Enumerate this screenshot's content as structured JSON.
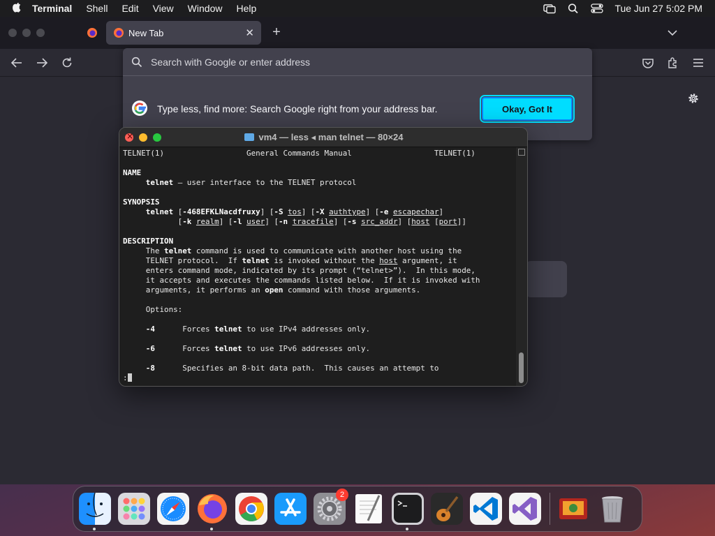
{
  "menubar": {
    "app_name": "Terminal",
    "menus": [
      "Shell",
      "Edit",
      "View",
      "Window",
      "Help"
    ],
    "clock": "Tue Jun 27  5:02 PM"
  },
  "browser": {
    "tab_title": "New Tab",
    "tab_close": "✕",
    "new_tab": "+",
    "search_placeholder": "Search with Google or enter address",
    "promo_text": "Type less, find more: Search Google right from your address bar.",
    "promo_button": "Okay, Got It"
  },
  "terminal": {
    "title": "vm4 — less ◂ man telnet — 80×24",
    "lines": [
      [
        [
          "t",
          "TELNET(1)                  General Commands Manual                  TELNET(1)"
        ]
      ],
      [],
      [
        [
          "b",
          "NAME"
        ]
      ],
      [
        [
          "t",
          "     "
        ],
        [
          "b",
          "telnet"
        ],
        [
          "t",
          " – user interface to the TELNET protocol"
        ]
      ],
      [],
      [
        [
          "b",
          "SYNOPSIS"
        ]
      ],
      [
        [
          "t",
          "     "
        ],
        [
          "b",
          "telnet"
        ],
        [
          "t",
          " ["
        ],
        [
          "b",
          "-468EFKLNacdfruxy"
        ],
        [
          "t",
          "] ["
        ],
        [
          "b",
          "-S"
        ],
        [
          "t",
          " "
        ],
        [
          "u",
          "tos"
        ],
        [
          "t",
          "] ["
        ],
        [
          "b",
          "-X"
        ],
        [
          "t",
          " "
        ],
        [
          "u",
          "authtype"
        ],
        [
          "t",
          "] ["
        ],
        [
          "b",
          "-e"
        ],
        [
          "t",
          " "
        ],
        [
          "u",
          "escapechar"
        ],
        [
          "t",
          "]"
        ]
      ],
      [
        [
          "t",
          "            ["
        ],
        [
          "b",
          "-k"
        ],
        [
          "t",
          " "
        ],
        [
          "u",
          "realm"
        ],
        [
          "t",
          "] ["
        ],
        [
          "b",
          "-l"
        ],
        [
          "t",
          " "
        ],
        [
          "u",
          "user"
        ],
        [
          "t",
          "] ["
        ],
        [
          "b",
          "-n"
        ],
        [
          "t",
          " "
        ],
        [
          "u",
          "tracefile"
        ],
        [
          "t",
          "] ["
        ],
        [
          "b",
          "-s"
        ],
        [
          "t",
          " "
        ],
        [
          "u",
          "src_addr"
        ],
        [
          "t",
          "] ["
        ],
        [
          "u",
          "host"
        ],
        [
          "t",
          " ["
        ],
        [
          "u",
          "port"
        ],
        [
          "t",
          "]]"
        ]
      ],
      [],
      [
        [
          "b",
          "DESCRIPTION"
        ]
      ],
      [
        [
          "t",
          "     The "
        ],
        [
          "b",
          "telnet"
        ],
        [
          "t",
          " command is used to communicate with another host using the"
        ]
      ],
      [
        [
          "t",
          "     TELNET protocol.  If "
        ],
        [
          "b",
          "telnet"
        ],
        [
          "t",
          " is invoked without the "
        ],
        [
          "u",
          "host"
        ],
        [
          "t",
          " argument, it"
        ]
      ],
      [
        [
          "t",
          "     enters command mode, indicated by its prompt (“telnet>”).  In this mode,"
        ]
      ],
      [
        [
          "t",
          "     it accepts and executes the commands listed below.  If it is invoked with"
        ]
      ],
      [
        [
          "t",
          "     arguments, it performs an "
        ],
        [
          "b",
          "open"
        ],
        [
          "t",
          " command with those arguments."
        ]
      ],
      [],
      [
        [
          "t",
          "     Options:"
        ]
      ],
      [],
      [
        [
          "t",
          "     "
        ],
        [
          "b",
          "-4"
        ],
        [
          "t",
          "      Forces "
        ],
        [
          "b",
          "telnet"
        ],
        [
          "t",
          " to use IPv4 addresses only."
        ]
      ],
      [],
      [
        [
          "t",
          "     "
        ],
        [
          "b",
          "-6"
        ],
        [
          "t",
          "      Forces "
        ],
        [
          "b",
          "telnet"
        ],
        [
          "t",
          " to use IPv6 addresses only."
        ]
      ],
      [],
      [
        [
          "t",
          "     "
        ],
        [
          "b",
          "-8"
        ],
        [
          "t",
          "      Specifies an 8-bit data path.  This causes an attempt to"
        ]
      ],
      [
        [
          "t",
          ":"
        ]
      ]
    ]
  },
  "dock": {
    "apps": [
      {
        "name": "finder",
        "running": true
      },
      {
        "name": "launchpad",
        "running": false
      },
      {
        "name": "safari",
        "running": false
      },
      {
        "name": "firefox",
        "running": true
      },
      {
        "name": "chrome",
        "running": false
      },
      {
        "name": "app-store",
        "running": false
      },
      {
        "name": "system-settings",
        "running": false,
        "badge": "2"
      },
      {
        "name": "textedit",
        "running": false
      },
      {
        "name": "terminal",
        "running": true
      },
      {
        "name": "garageband",
        "running": false
      },
      {
        "name": "vscode",
        "running": false
      },
      {
        "name": "visual-studio",
        "running": false
      }
    ],
    "extras": [
      "photo-booth",
      "trash"
    ]
  },
  "colors": {
    "firefox_bg": "#2b2a33",
    "accent_button": "#00ddff",
    "terminal_bg": "#1e1e1e"
  }
}
